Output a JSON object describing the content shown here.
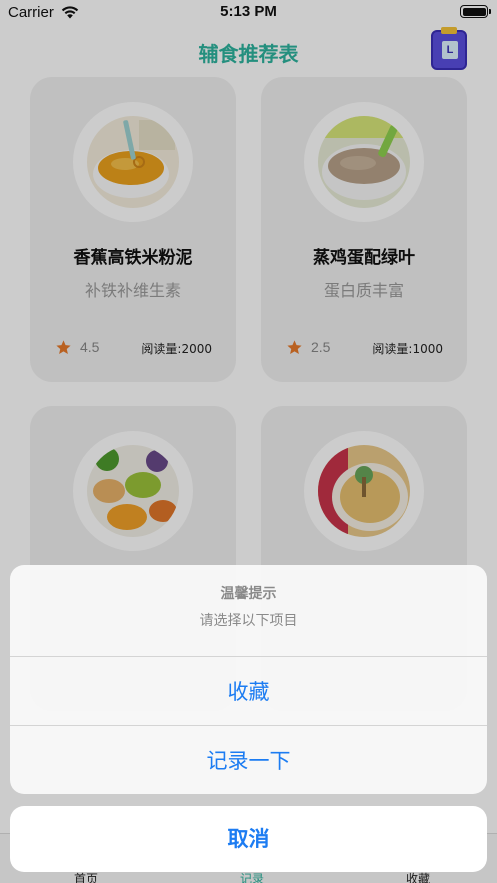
{
  "status_bar": {
    "carrier": "Carrier",
    "time": "5:13 PM"
  },
  "nav": {
    "title": "辅食推荐表",
    "record_button_letter": "L"
  },
  "cards": [
    {
      "title": "香蕉高铁米粉泥",
      "subtitle": "补铁补维生素",
      "rating": "4.5",
      "reads": "阅读量:2000",
      "image": "banana-rice-puree-photo"
    },
    {
      "title": "蒸鸡蛋配绿叶",
      "subtitle": "蛋白质丰富",
      "rating": "2.5",
      "reads": "阅读量:1000",
      "image": "steamed-egg-greens-photo"
    },
    {
      "title": "",
      "subtitle": "",
      "rating": "",
      "reads": "",
      "image": "vegetable-puree-jars-photo"
    },
    {
      "title": "",
      "subtitle": "",
      "rating": "",
      "reads": "",
      "image": "pumpkin-soup-photo"
    }
  ],
  "tabs": [
    {
      "label": "首页"
    },
    {
      "label": "记录",
      "active": true
    },
    {
      "label": "收藏"
    }
  ],
  "action_sheet": {
    "title": "温馨提示",
    "message": "请选择以下项目",
    "actions": [
      "收藏",
      "记录一下"
    ],
    "cancel": "取消"
  },
  "colors": {
    "accent": "#2db39e",
    "star": "#e87a2a",
    "action_blue": "#1c7cf2"
  }
}
